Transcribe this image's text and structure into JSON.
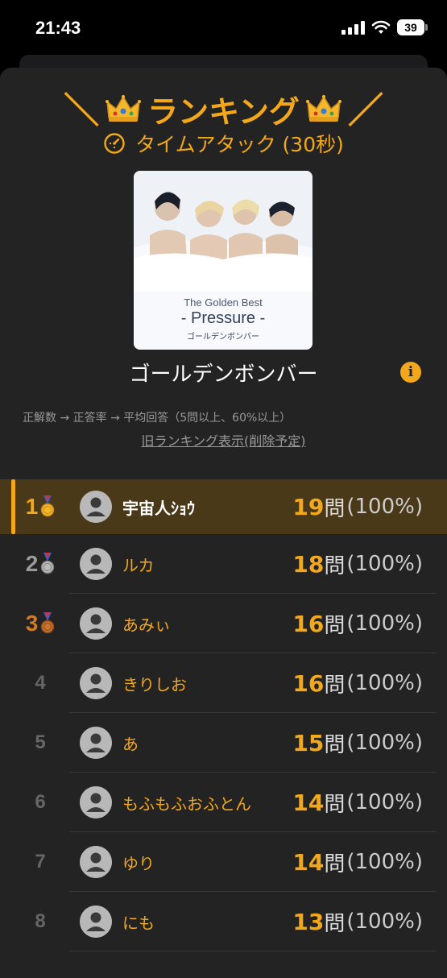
{
  "status": {
    "time": "21:43",
    "battery": "39"
  },
  "header": {
    "title": "ランキング",
    "slash_left": "＼",
    "slash_right": "／",
    "subtitle": "タイムアタック (30秒)"
  },
  "album": {
    "line1": "The Golden Best",
    "line2": "- Pressure -",
    "line3": "ゴールデンボンバー",
    "artist": "ゴールデンボンバー"
  },
  "criteria": "正解数 → 正答率 → 平均回答（5問以上、60%以上）",
  "old_ranking_link": "旧ランキング表示(削除予定)",
  "unit": "問",
  "colors": {
    "accent": "#f3a71a",
    "background": "#232323",
    "highlight": "#4a3918"
  },
  "rankings": [
    {
      "rank": "1",
      "name": "宇宙人ｼｮｳ",
      "score": "19",
      "pct": "(100%)",
      "medal": "gold"
    },
    {
      "rank": "2",
      "name": "ルカ",
      "score": "18",
      "pct": "(100%)",
      "medal": "silver"
    },
    {
      "rank": "3",
      "name": "あみぃ",
      "score": "16",
      "pct": "(100%)",
      "medal": "bronze"
    },
    {
      "rank": "4",
      "name": "きりしお",
      "score": "16",
      "pct": "(100%)"
    },
    {
      "rank": "5",
      "name": "あ",
      "score": "15",
      "pct": "(100%)"
    },
    {
      "rank": "6",
      "name": "もふもふおふとん",
      "score": "14",
      "pct": "(100%)"
    },
    {
      "rank": "7",
      "name": "ゆり",
      "score": "14",
      "pct": "(100%)"
    },
    {
      "rank": "8",
      "name": "にも",
      "score": "13",
      "pct": "(100%)"
    }
  ]
}
